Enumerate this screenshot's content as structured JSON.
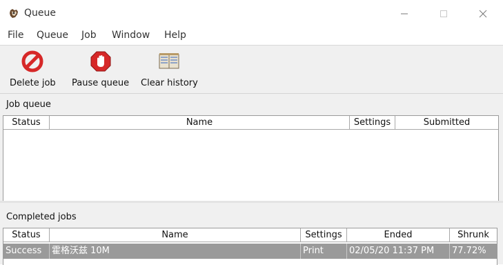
{
  "window": {
    "title": "Queue"
  },
  "menu": [
    "File",
    "Queue",
    "Job",
    "Window",
    "Help"
  ],
  "toolbar": {
    "delete_label": "Delete job",
    "pause_label": "Pause queue",
    "clear_label": "Clear history"
  },
  "job_queue": {
    "title": "Job queue",
    "columns": [
      "Status",
      "Name",
      "Settings",
      "Submitted"
    ],
    "rows": []
  },
  "completed_jobs": {
    "title": "Completed jobs",
    "columns": [
      "Status",
      "Name",
      "Settings",
      "Ended",
      "Shrunk"
    ],
    "rows": [
      {
        "status": "Success",
        "name": "霍格沃兹 10M",
        "settings": "Print",
        "ended": "02/05/20 11:37 PM",
        "shrunk": "77.72%"
      }
    ]
  },
  "colors": {
    "selected_row": "#9a9a9a",
    "delete_icon": "#d62828",
    "pause_icon": "#d62828"
  }
}
